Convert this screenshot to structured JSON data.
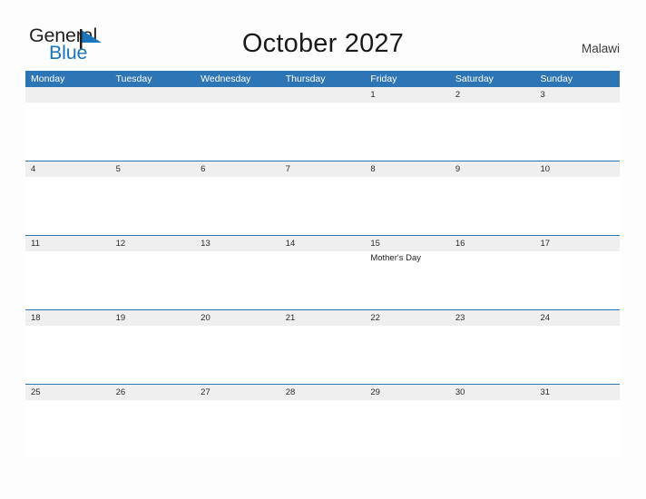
{
  "logo": {
    "word_one": "General",
    "word_two": "Blue",
    "flag_icon": "blue-triangle-flag-icon",
    "black_color": "#231f20",
    "blue_color": "#1b75bb"
  },
  "header": {
    "title": "October 2027",
    "country": "Malawi"
  },
  "theme": {
    "header_blue": "#2e75b6",
    "date_band_gray": "#efefef",
    "page_background": "#fdfdfd",
    "text_dark": "#1a1a1a"
  },
  "calendar": {
    "month": "October",
    "year": "2027",
    "weekday_headers": [
      "Monday",
      "Tuesday",
      "Wednesday",
      "Thursday",
      "Friday",
      "Saturday",
      "Sunday"
    ],
    "weeks": [
      {
        "days": [
          {
            "date": "",
            "events": []
          },
          {
            "date": "",
            "events": []
          },
          {
            "date": "",
            "events": []
          },
          {
            "date": "",
            "events": []
          },
          {
            "date": "1",
            "events": []
          },
          {
            "date": "2",
            "events": []
          },
          {
            "date": "3",
            "events": []
          }
        ]
      },
      {
        "days": [
          {
            "date": "4",
            "events": []
          },
          {
            "date": "5",
            "events": []
          },
          {
            "date": "6",
            "events": []
          },
          {
            "date": "7",
            "events": []
          },
          {
            "date": "8",
            "events": []
          },
          {
            "date": "9",
            "events": []
          },
          {
            "date": "10",
            "events": []
          }
        ]
      },
      {
        "days": [
          {
            "date": "11",
            "events": []
          },
          {
            "date": "12",
            "events": []
          },
          {
            "date": "13",
            "events": []
          },
          {
            "date": "14",
            "events": []
          },
          {
            "date": "15",
            "events": [
              "Mother's Day"
            ]
          },
          {
            "date": "16",
            "events": []
          },
          {
            "date": "17",
            "events": []
          }
        ]
      },
      {
        "days": [
          {
            "date": "18",
            "events": []
          },
          {
            "date": "19",
            "events": []
          },
          {
            "date": "20",
            "events": []
          },
          {
            "date": "21",
            "events": []
          },
          {
            "date": "22",
            "events": []
          },
          {
            "date": "23",
            "events": []
          },
          {
            "date": "24",
            "events": []
          }
        ]
      },
      {
        "days": [
          {
            "date": "25",
            "events": []
          },
          {
            "date": "26",
            "events": []
          },
          {
            "date": "27",
            "events": []
          },
          {
            "date": "28",
            "events": []
          },
          {
            "date": "29",
            "events": []
          },
          {
            "date": "30",
            "events": []
          },
          {
            "date": "31",
            "events": []
          }
        ]
      }
    ]
  }
}
